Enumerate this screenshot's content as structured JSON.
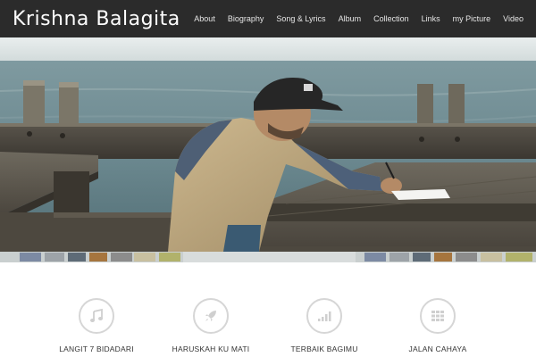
{
  "header": {
    "brand": "Krishna Balagita",
    "nav": [
      "About",
      "Biography",
      "Song & Lyrics",
      "Album",
      "Collection",
      "Links",
      "my Picture",
      "Video"
    ]
  },
  "hero": {
    "image": "man-writing-at-lakeside-table-photo"
  },
  "features": [
    {
      "icon": "music-note-icon",
      "label": "LANGIT 7 BIDADARI"
    },
    {
      "icon": "rocket-icon",
      "label": "HARUSKAH KU MATI"
    },
    {
      "icon": "signal-bars-icon",
      "label": "TERBAIK BAGIMU"
    },
    {
      "icon": "grid-icon",
      "label": "JALAN CAHAYA"
    }
  ],
  "colors": {
    "navbar": "#2b2b2b",
    "icon_gray": "#d6d6d6"
  }
}
